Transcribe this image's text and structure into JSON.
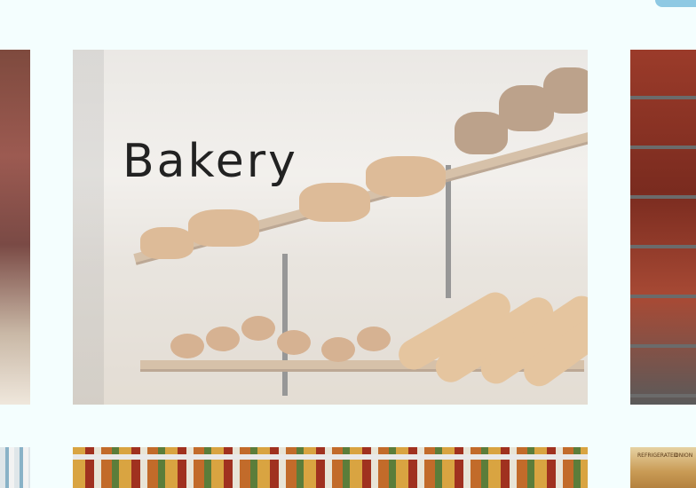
{
  "categories": {
    "main": {
      "title": "Bakery"
    }
  },
  "product_labels": {
    "left": "REFRIGERATED",
    "right": "ONION"
  },
  "colors": {
    "page_background": "#f4fefe",
    "accent_button": "#8ec9e3",
    "title_text": "#222222"
  }
}
